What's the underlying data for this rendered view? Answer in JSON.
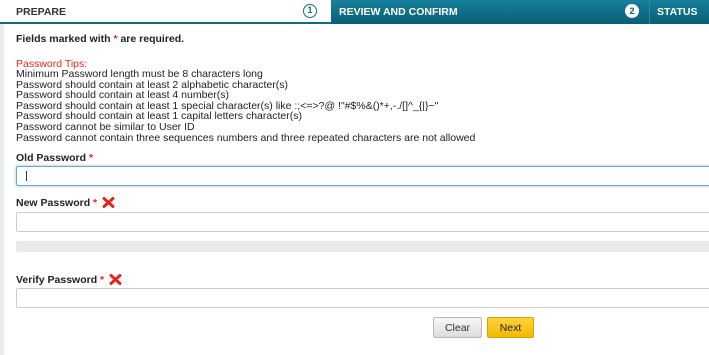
{
  "wizard": {
    "steps": [
      {
        "label": "PREPARE",
        "number": "1",
        "active": true
      },
      {
        "label": "REVIEW AND CONFIRM",
        "number": "2",
        "active": false
      },
      {
        "label": "STATUS",
        "active": false
      }
    ]
  },
  "form": {
    "required_note_prefix": "Fields marked with",
    "required_star": "*",
    "required_note_suffix": "are required.",
    "tips_title": "Password Tips:",
    "tips": [
      "Minimum Password length must be 8 characters long",
      "Password should contain at least 2 alphabetic character(s)",
      "Password should contain at least 4 number(s)",
      "Password should contain at least 1 special character(s) like :;<=>?@ !\"#$%&()*+,-./[]^_{|}~\"",
      "Password should contain at least 1 capital letters character(s)",
      "Password cannot be similar to User ID",
      "Password cannot contain three sequences numbers and three repeated characters are not allowed"
    ],
    "old_password_label": "Old Password",
    "new_password_label": "New Password",
    "verify_password_label": "Verify Password",
    "old_password_value": "",
    "new_password_value": "",
    "verify_password_value": "",
    "invalid_icon": "red-x-icon"
  },
  "buttons": {
    "clear_label": "Clear",
    "next_label": "Next"
  },
  "colors": {
    "accent": "#0e6b84",
    "required": "#e3261b",
    "primary_button": "#f3b800"
  }
}
